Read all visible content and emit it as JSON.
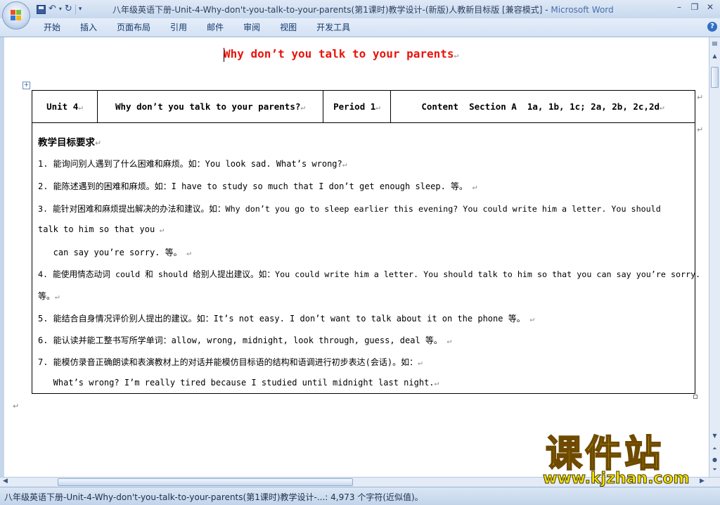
{
  "window": {
    "title": "八年级英语下册-Unit-4-Why-don't-you-talk-to-your-parents(第1课时)教学设计-(新版)人教新目标版 [兼容模式]",
    "separator": " - ",
    "app_name": "Microsoft Word"
  },
  "ribbon": {
    "tabs": [
      "开始",
      "插入",
      "页面布局",
      "引用",
      "邮件",
      "审阅",
      "视图",
      "开发工具"
    ]
  },
  "document": {
    "title": "Why don’t you talk to your parents",
    "table_header": {
      "unit": "Unit 4",
      "lesson": "Why don’t you talk to your parents?",
      "period": "Period 1",
      "content": "Content  Section A  1a, 1b, 1c; 2a, 2b, 2c,2d"
    },
    "goals_heading": "教学目标要求",
    "goals": [
      "1. 能询问别人遇到了什么困难和麻烦。如：You look sad. What’s wrong?",
      "2. 能陈述遇到的困难和麻烦。如：I have to study so much that I don’t get enough sleep. 等。",
      "3. 能针对困难和麻烦提出解决的办法和建议。如：Why don’t you go to sleep earlier this evening? You could write him a letter. You should",
      "talk to him so that you",
      "   can say you’re sorry. 等。",
      "4. 能使用情态动词 could 和 should 给别人提出建议。如：You could write him a letter. You should talk to him so that you can say you’re sorry.",
      "等。",
      "5. 能结合自身情况评价别人提出的建议。如：It’s not easy. I don’t want to talk about it on the phone 等。",
      "6. 能认读并能工整书写所学单词：allow, wrong, midnight, look through, guess, deal 等。",
      "7. 能模仿录音正确朗读和表演教材上的对话并能模仿目标语的结构和语调进行初步表达(会话)。如：",
      "   What’s wrong? I’m really tired because I studied until midnight last night."
    ]
  },
  "statusbar": {
    "text": "八年级英语下册-Unit-4-Why-don't-you-talk-to-your-parents(第1课时)教学设计-...: 4,973 个字符(近似值)。"
  },
  "watermark": {
    "name": "课件站",
    "url": "www.kjzhan.com"
  },
  "icons": {
    "save": "save-icon",
    "undo": "undo-icon",
    "redo": "redo-icon",
    "customize": "customize-qat-icon",
    "minimize": "minimize-icon",
    "restore": "restore-icon",
    "close": "close-icon",
    "help": "help-icon",
    "table_anchor": "table-move-icon",
    "paragraph_mark": "↵"
  },
  "colors": {
    "title_red": "#e8140d",
    "chrome_blue": "#c7d8ee",
    "watermark_yellow": "#f3e500"
  }
}
